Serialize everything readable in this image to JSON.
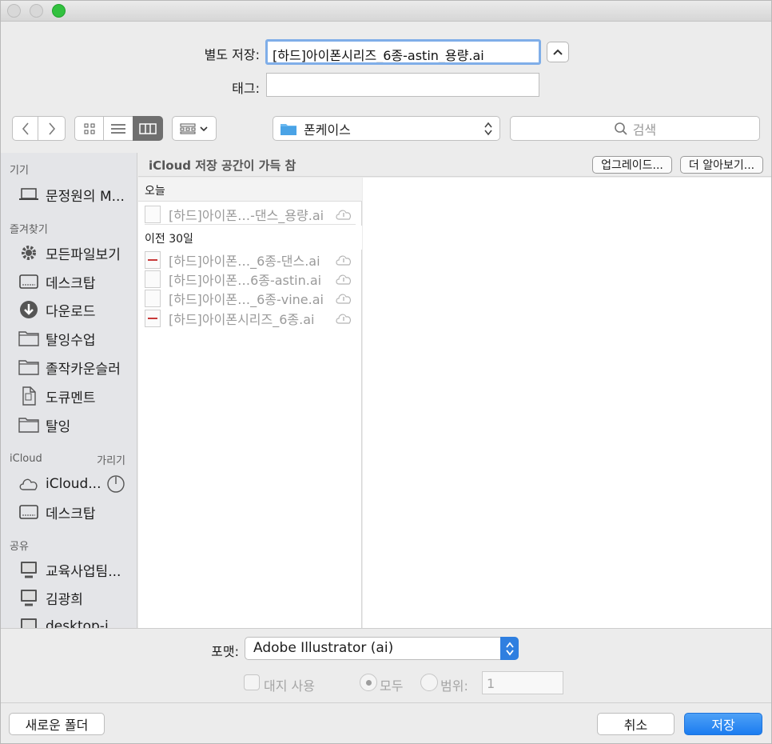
{
  "dialog": {
    "save_as_label": "별도 저장:",
    "filename": "[하드]아이폰시리즈_6종-astin_용량.ai",
    "tags_label": "태그:",
    "tags_value": ""
  },
  "toolbar": {
    "location": "폰케이스",
    "search_placeholder": "검색"
  },
  "sidebar": {
    "devices_header": "기기",
    "devices": [
      {
        "label": "문정원의 M...",
        "icon": "laptop-icon"
      }
    ],
    "favorites_header": "즐겨찾기",
    "favorites": [
      {
        "label": "모든파일보기",
        "icon": "gear-icon"
      },
      {
        "label": "데스크탑",
        "icon": "desktop-icon"
      },
      {
        "label": "다운로드",
        "icon": "download-icon"
      },
      {
        "label": "탈잉수업",
        "icon": "folder-icon"
      },
      {
        "label": "졸작카운슬러",
        "icon": "folder-icon"
      },
      {
        "label": "도큐멘트",
        "icon": "document-icon"
      },
      {
        "label": "탈잉",
        "icon": "folder-icon"
      }
    ],
    "icloud_header": "iCloud",
    "icloud_hide": "가리기",
    "icloud": [
      {
        "label": "iCloud...",
        "icon": "cloud-icon"
      },
      {
        "label": "데스크탑",
        "icon": "desktop-icon"
      }
    ],
    "shared_header": "공유",
    "shared": [
      {
        "label": "교육사업팀...",
        "icon": "computer-icon"
      },
      {
        "label": "김광희",
        "icon": "computer-icon"
      },
      {
        "label": "desktop-i...",
        "icon": "computer-icon"
      }
    ]
  },
  "infobar": {
    "text": "iCloud 저장 공간이 가득 참",
    "upgrade": "업그레이드...",
    "learn_more": "더 알아보기..."
  },
  "browser": {
    "today_header": "오늘",
    "today_files": [
      "[하드]아이폰…-댄스_용량.ai"
    ],
    "prev_header": "이전 30일",
    "prev_files": [
      "[하드]아이폰…_6종-댄스.ai",
      "[하드]아이폰…6종-astin.ai",
      "[하드]아이폰…_6종-vine.ai",
      "[하드]아이폰시리즈_6종.ai"
    ]
  },
  "options": {
    "format_label": "포맷:",
    "format_value": "Adobe Illustrator (ai)",
    "artboards_label": "대지 사용",
    "all_label": "모두",
    "range_label": "범위:",
    "range_value": "1"
  },
  "buttons": {
    "new_folder": "새로운 폴더",
    "cancel": "취소",
    "save": "저장"
  },
  "colors": {
    "accent": "#1b7cf0",
    "sidebar_bg": "#e4e5e8",
    "zoom_green": "#32c13f"
  }
}
